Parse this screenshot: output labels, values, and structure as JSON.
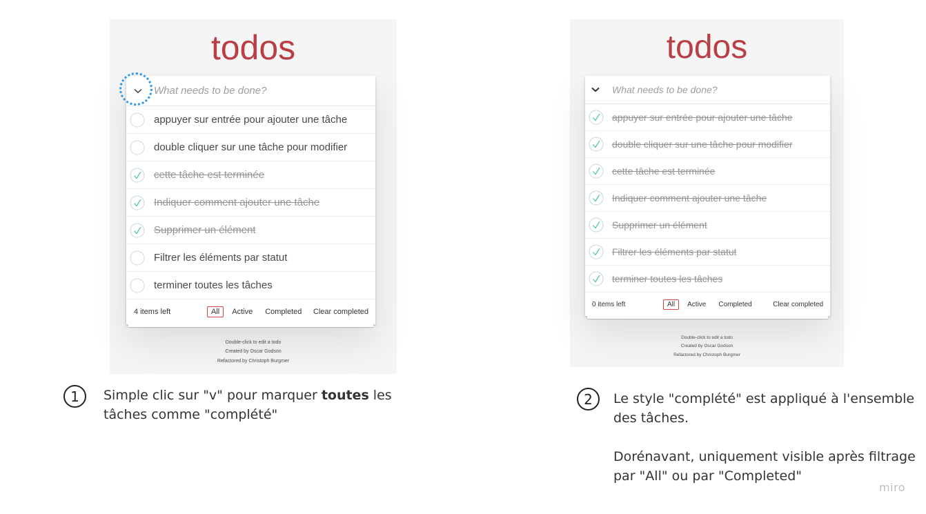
{
  "panel1": {
    "logo": "todos",
    "input_placeholder": "What needs to be done?",
    "items": [
      {
        "label": "appuyer sur entrée pour ajouter une tâche",
        "completed": false
      },
      {
        "label": "double cliquer sur une tâche pour modifier",
        "completed": false
      },
      {
        "label": "cette tâche est terminée",
        "completed": true
      },
      {
        "label": "Indiquer comment ajouter une tâche",
        "completed": true
      },
      {
        "label": "Supprimer un élément",
        "completed": true
      },
      {
        "label": "Filtrer les éléments par statut",
        "completed": false
      },
      {
        "label": "terminer toutes les tâches",
        "completed": false
      }
    ],
    "footer": {
      "count": "4 items left",
      "all": "All",
      "active": "Active",
      "completed": "Completed",
      "clear": "Clear completed"
    },
    "info": [
      "Double-click to edit a todo",
      "Created by Oscar Godson",
      "Refactored by Christoph Burgmer"
    ]
  },
  "panel2": {
    "logo": "todos",
    "input_placeholder": "What needs to be done?",
    "items": [
      {
        "label": "appuyer sur entrée pour ajouter une tâche",
        "completed": true
      },
      {
        "label": "double cliquer sur une tâche pour modifier",
        "completed": true
      },
      {
        "label": "cette tâche est terminée",
        "completed": true
      },
      {
        "label": "Indiquer comment ajouter une tâche",
        "completed": true
      },
      {
        "label": "Supprimer un élément",
        "completed": true
      },
      {
        "label": "Filtrer les éléments par statut",
        "completed": true
      },
      {
        "label": "terminer toutes les tâches",
        "completed": true
      }
    ],
    "footer": {
      "count": "0 items left",
      "all": "All",
      "active": "Active",
      "completed": "Completed",
      "clear": "Clear completed"
    },
    "info": [
      "Double-click to edit a todo",
      "Created by Oscar Godson",
      "Refactored by Christoph Burgmer"
    ]
  },
  "caption1": {
    "number": "1",
    "before": "Simple clic sur \"v\" pour marquer ",
    "bold": "toutes",
    "after": " les tâches comme \"complété\""
  },
  "caption2": {
    "number": "2",
    "line1": "Le style \"complété\" est appliqué à l'ensemble des tâches.",
    "line2": "Dorénavant, uniquement visible après filtrage par \"All\" ou par \"Completed\""
  },
  "watermark": "miro",
  "colors": {
    "logo": "#b83f45",
    "check": "#5dc2af",
    "highlight": "#3399e6",
    "selected_filter": "#ce4646"
  }
}
